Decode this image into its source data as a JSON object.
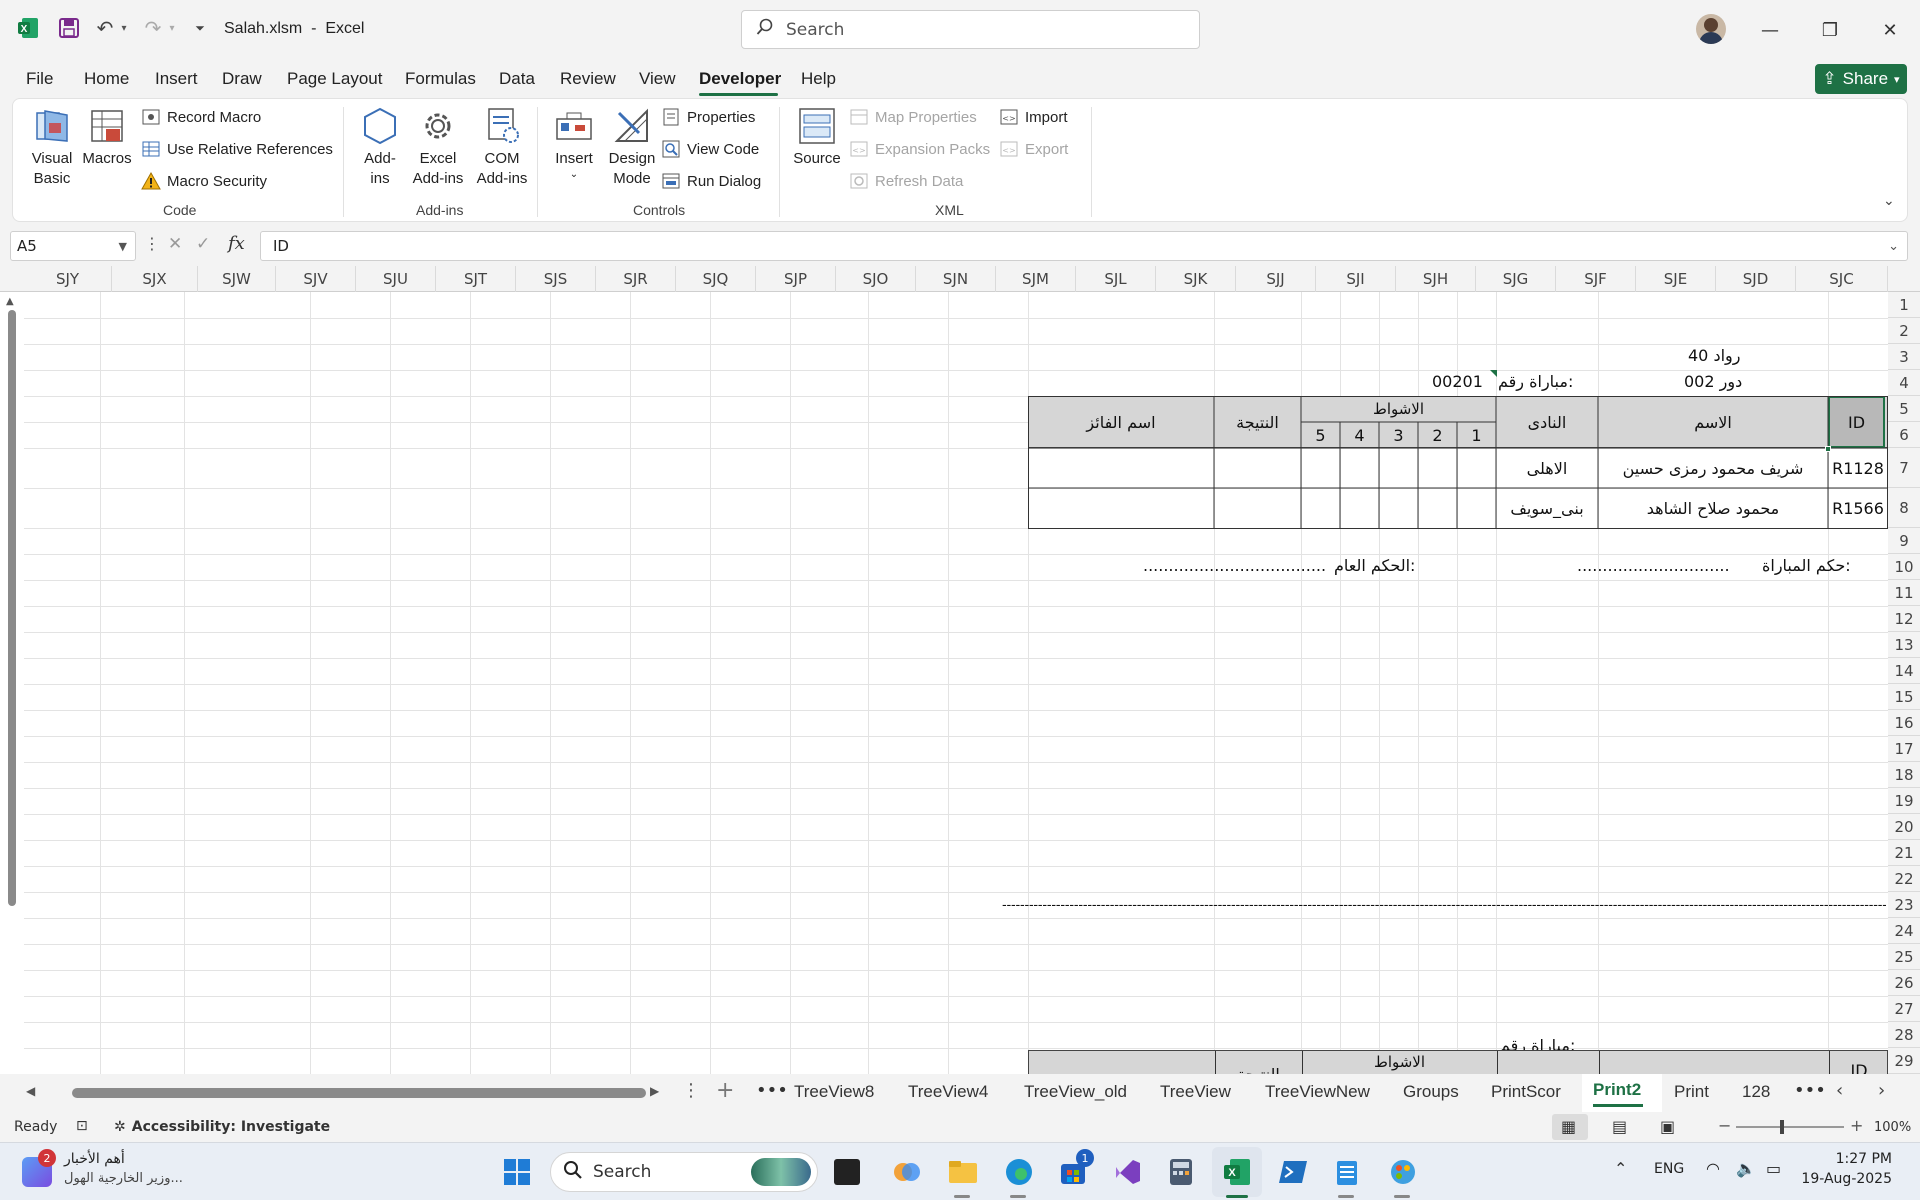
{
  "window": {
    "filename": "Salah.xlsm",
    "separator": "-",
    "app": "Excel",
    "search_placeholder": "Search"
  },
  "menu": {
    "tabs": [
      "File",
      "Home",
      "Insert",
      "Draw",
      "Page Layout",
      "Formulas",
      "Data",
      "Review",
      "View",
      "Developer",
      "Help"
    ],
    "active": "Developer",
    "share_label": "Share"
  },
  "ribbon": {
    "code": {
      "label": "Code",
      "visual_basic": "Visual\nBasic",
      "macros": "Macros",
      "record_macro": "Record Macro",
      "use_relative": "Use Relative References",
      "macro_security": "Macro Security"
    },
    "addins": {
      "label": "Add-ins",
      "addins": "Add-\nins",
      "excel_addins": "Excel\nAdd-ins",
      "com_addins": "COM\nAdd-ins"
    },
    "controls": {
      "label": "Controls",
      "insert": "Insert",
      "design_mode": "Design\nMode",
      "properties": "Properties",
      "view_code": "View Code",
      "run_dialog": "Run Dialog"
    },
    "xml": {
      "label": "XML",
      "source": "Source",
      "map_properties": "Map Properties",
      "expansion_packs": "Expansion Packs",
      "refresh_data": "Refresh Data",
      "import": "Import",
      "export": "Export"
    }
  },
  "formula_bar": {
    "name_box": "A5",
    "fx": "fx",
    "content": "ID"
  },
  "columns": [
    "SJY",
    "SJX",
    "SJW",
    "SJV",
    "SJU",
    "SJT",
    "SJS",
    "SJR",
    "SJQ",
    "SJP",
    "SJO",
    "SJN",
    "SJM",
    "SJL",
    "SJK",
    "SJJ",
    "SJI",
    "SJH",
    "SJG",
    "SJF",
    "SJE",
    "SJD",
    "SJC"
  ],
  "rows": [
    "1",
    "2",
    "3",
    "4",
    "5",
    "6",
    "7",
    "8",
    "9",
    "10",
    "11",
    "12",
    "13",
    "14",
    "15",
    "16",
    "17",
    "18",
    "19",
    "20",
    "21",
    "22",
    "23",
    "24",
    "25",
    "26",
    "27",
    "28",
    "29"
  ],
  "sheet": {
    "title_line1": "رواد 40",
    "title_line2": "دور 002",
    "match_no_label": "مباراة رقم:",
    "match_no_value": "00201",
    "headers": {
      "id": "ID",
      "name": "الاسم",
      "club": "النادى",
      "rounds": "الاشواط",
      "round_nums": [
        "1",
        "2",
        "3",
        "4",
        "5"
      ],
      "result": "النتيجة",
      "winner": "اسم الفائز"
    },
    "players": [
      {
        "id": "R1128",
        "name": "شريف محمود رمزى حسين",
        "club": "الاهلى"
      },
      {
        "id": "R1566",
        "name": "محمود صلاح الشاهد",
        "club": "بنى_سويف"
      }
    ],
    "referee_label": "حكم المباراة:",
    "referee_dots": "..............................",
    "general_ref_label": "الحكم العام:",
    "general_ref_dots": "....................................",
    "separator_line": "-----------------------------------------------------------------------------------------------------------------------------------------------------------------------------------------------------------------------",
    "match_no_label_2": "مباراة رقم:",
    "rounds_2": "الاشواط",
    "id_2": "ID",
    "result_2_partial": "النتيجة"
  },
  "sheet_tabs": [
    "TreeView8",
    "TreeView4",
    "TreeView_old",
    "TreeView",
    "TreeViewNew",
    "Groups",
    "PrintScor",
    "Print2",
    "Print",
    "128"
  ],
  "active_sheet": "Print2",
  "status": {
    "ready": "Ready",
    "accessibility": "Accessibility: Investigate",
    "zoom": "100%"
  },
  "taskbar": {
    "news_badge": "2",
    "news_title": "أهم الأخبار",
    "news_sub": "وزير الخارجية الهول...",
    "search": "Search",
    "store_badge": "1",
    "lang": "ENG",
    "time": "1:27 PM",
    "date": "19-Aug-2025"
  },
  "colors": {
    "excel_green": "#1e7145",
    "header_fill": "#d6d6d6"
  }
}
